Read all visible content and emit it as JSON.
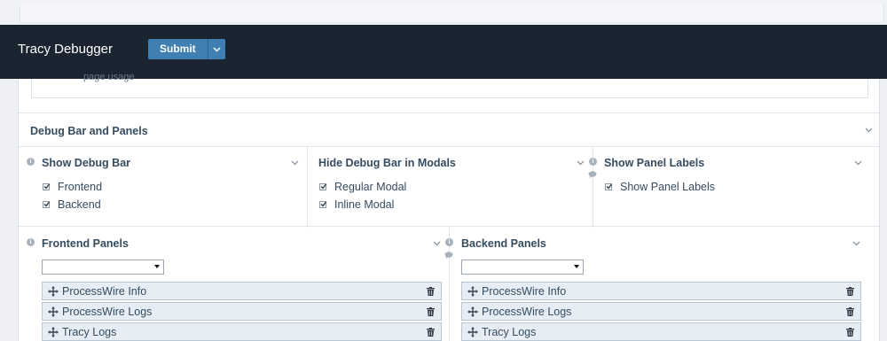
{
  "app": {
    "title": "Tracy Debugger",
    "submit_label": "Submit"
  },
  "previous_field": {
    "cut_text": "page usage"
  },
  "fieldset": {
    "label": "Debug Bar and Panels"
  },
  "show_debug_bar": {
    "label": "Show Debug Bar",
    "options": [
      {
        "label": "Frontend",
        "checked": true
      },
      {
        "label": "Backend",
        "checked": true
      }
    ]
  },
  "hide_in_modals": {
    "label": "Hide Debug Bar in Modals",
    "options": [
      {
        "label": "Regular Modal",
        "checked": true
      },
      {
        "label": "Inline Modal",
        "checked": true
      }
    ]
  },
  "panel_labels": {
    "label": "Show Panel Labels",
    "options": [
      {
        "label": "Show Panel Labels",
        "checked": true
      }
    ]
  },
  "frontend_panels": {
    "label": "Frontend Panels",
    "select_value": "",
    "items": [
      "ProcessWire Info",
      "ProcessWire Logs",
      "Tracy Logs"
    ]
  },
  "backend_panels": {
    "label": "Backend Panels",
    "select_value": "",
    "items": [
      "ProcessWire Info",
      "ProcessWire Logs",
      "Tracy Logs"
    ]
  },
  "colors": {
    "topbar": "#1b2431",
    "accent": "#3f7fb2",
    "text": "#354b60",
    "panel_item_bg": "#e7edf4"
  }
}
